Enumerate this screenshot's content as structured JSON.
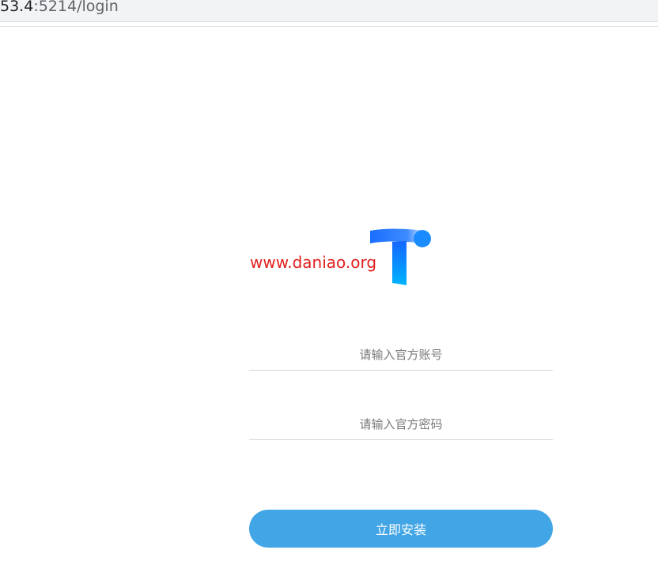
{
  "browser": {
    "address_host": "53.4",
    "address_path": ":5214/login"
  },
  "login": {
    "watermark_text": "www.daniao.org",
    "logo_icon": "t-logo-icon",
    "account_placeholder": "请输入官方账号",
    "password_placeholder": "请输入官方密码",
    "install_button_label": "立即安装"
  },
  "colors": {
    "accent": "#42a5e6",
    "logo_blue": "#1e7bff",
    "watermark": "#e02020"
  }
}
